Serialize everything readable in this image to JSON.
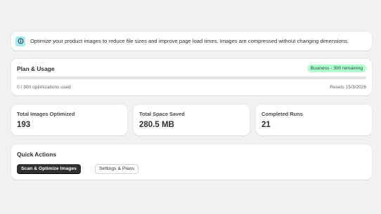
{
  "banner": {
    "icon": "info-icon",
    "text": "Optimize your product images to reduce file sizes and improve page load times. Images are compressed without changing dimensions."
  },
  "plan": {
    "title": "Plan & Usage",
    "badge": "Business - 300 remaining",
    "used_text": "0 / 300 optimizations used",
    "progress_fraction": 0,
    "reset_text": "Resets 15/3/2026"
  },
  "stats": [
    {
      "label": "Total Images Optimized",
      "value": "193"
    },
    {
      "label": "Total Space Saved",
      "value": "280.5 MB"
    },
    {
      "label": "Completed Runs",
      "value": "21"
    }
  ],
  "quick_actions": {
    "title": "Quick Actions",
    "primary_label": "Scan & Optimize Images",
    "secondary_label": "Settings & Plans"
  },
  "colors": {
    "page_bg": "#f1f1f1",
    "info_icon_bg": "#a4e8f2",
    "badge_bg": "#b4fed2",
    "badge_text": "#0c5132",
    "primary_button": "#303030"
  }
}
